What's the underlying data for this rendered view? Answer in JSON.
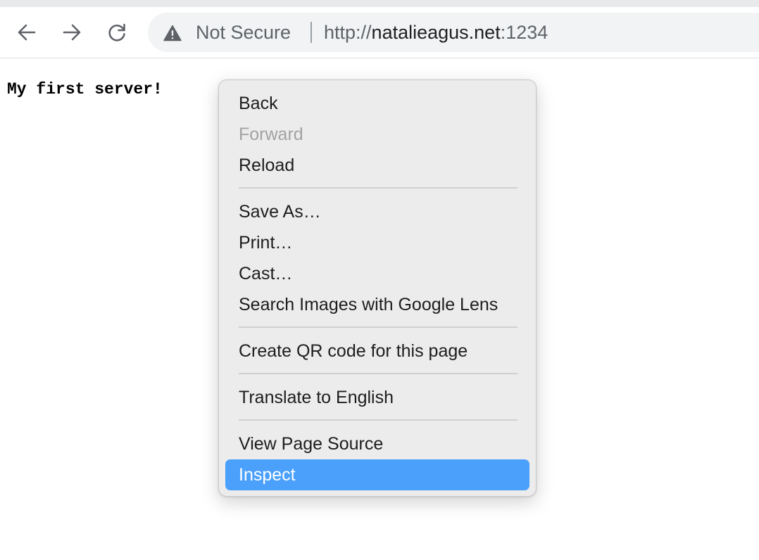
{
  "browser": {
    "security_label": "Not Secure",
    "url": {
      "scheme": "http://",
      "host": "natalieagus.net",
      "port": ":1234"
    },
    "icons": {
      "back": "arrow-left-icon",
      "forward": "arrow-right-icon",
      "reload": "reload-icon",
      "security": "warning-triangle-icon"
    }
  },
  "page": {
    "body_text": "My first server!"
  },
  "context_menu": {
    "items": [
      {
        "label": "Back",
        "enabled": true
      },
      {
        "label": "Forward",
        "enabled": false
      },
      {
        "label": "Reload",
        "enabled": true
      },
      {
        "label": "Save As…",
        "enabled": true
      },
      {
        "label": "Print…",
        "enabled": true
      },
      {
        "label": "Cast…",
        "enabled": true
      },
      {
        "label": "Search Images with Google Lens",
        "enabled": true
      },
      {
        "label": "Create QR code for this page",
        "enabled": true
      },
      {
        "label": "Translate to English",
        "enabled": true
      },
      {
        "label": "View Page Source",
        "enabled": true
      },
      {
        "label": "Inspect",
        "enabled": true,
        "highlighted": true
      }
    ],
    "highlight_color": "#4aa0fb"
  }
}
